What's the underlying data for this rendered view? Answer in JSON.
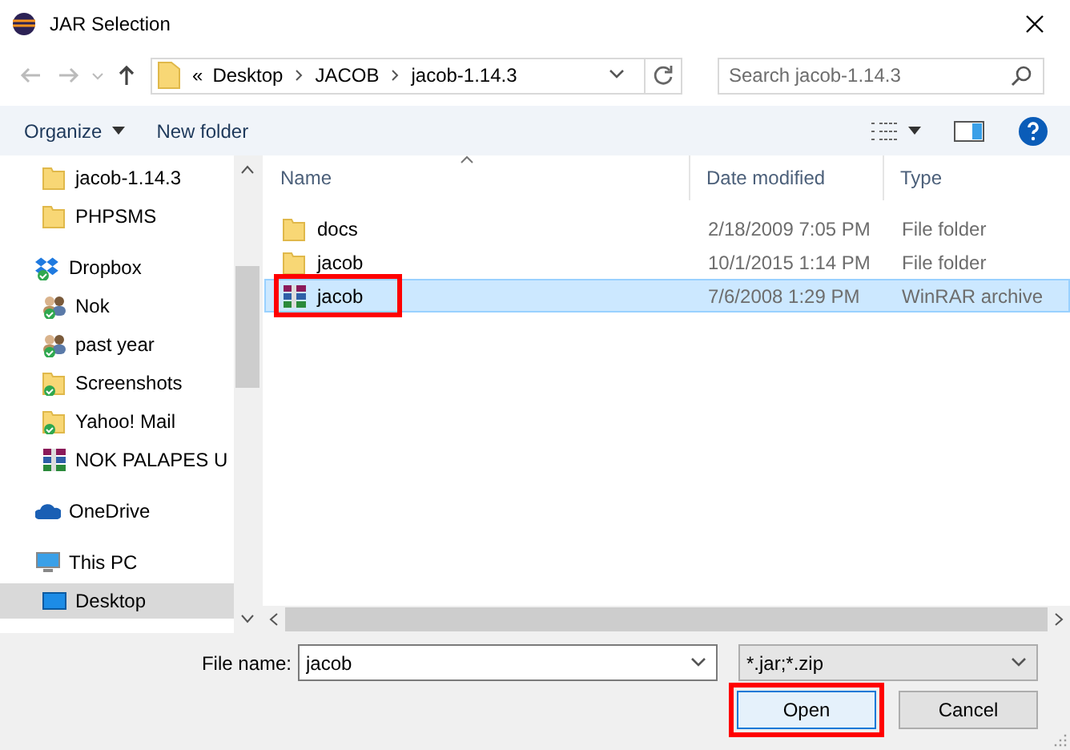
{
  "window": {
    "title": "JAR Selection"
  },
  "address": {
    "crumbs": [
      "«",
      "Desktop",
      "JACOB",
      "jacob-1.14.3"
    ]
  },
  "search": {
    "placeholder": "Search jacob-1.14.3"
  },
  "toolbar": {
    "buttons": [
      "Organize",
      "New folder"
    ]
  },
  "sidebar": {
    "items": [
      {
        "children": [
          {
            "kind": "folder",
            "label": "jacob-1.14.3",
            "selected": false
          },
          {
            "kind": "folder",
            "label": "PHPSMS",
            "selected": false
          }
        ]
      },
      {
        "kind": "dropbox",
        "label": "Dropbox",
        "selected": false,
        "children": [
          {
            "kind": "people",
            "label": "Nok",
            "selected": false
          },
          {
            "kind": "people",
            "label": "past year",
            "selected": false
          },
          {
            "kind": "synced-folder",
            "label": "Screenshots",
            "selected": false
          },
          {
            "kind": "synced-folder",
            "label": "Yahoo! Mail",
            "selected": false
          },
          {
            "kind": "archive",
            "label": "NOK PALAPES U",
            "selected": false
          }
        ]
      },
      {
        "kind": "cloud",
        "label": "OneDrive",
        "selected": false
      },
      {
        "kind": "pc",
        "label": "This PC",
        "selected": false,
        "children": [
          {
            "kind": "desktop",
            "label": "Desktop",
            "selected": true
          }
        ]
      }
    ]
  },
  "table": {
    "columns": [
      "Name",
      "Date modified",
      "Type"
    ],
    "rows": [
      {
        "kind": "folder",
        "name": "docs",
        "date": "2/18/2009 7:05 PM",
        "type": "File folder",
        "selected": false,
        "highlighted": false
      },
      {
        "kind": "folder",
        "name": "jacob",
        "date": "10/1/2015 1:14 PM",
        "type": "File folder",
        "selected": false,
        "highlighted": false
      },
      {
        "kind": "archive",
        "name": "jacob",
        "date": "7/6/2008 1:29 PM",
        "type": "WinRAR archive",
        "selected": true,
        "highlighted": true
      }
    ]
  },
  "footer": {
    "file_name_label": "File name:",
    "file_name": "jacob",
    "filter": "*.jar;*.zip",
    "buttons": [
      {
        "label": "Open",
        "highlighted": true
      },
      {
        "label": "Cancel",
        "highlighted": false
      }
    ]
  }
}
